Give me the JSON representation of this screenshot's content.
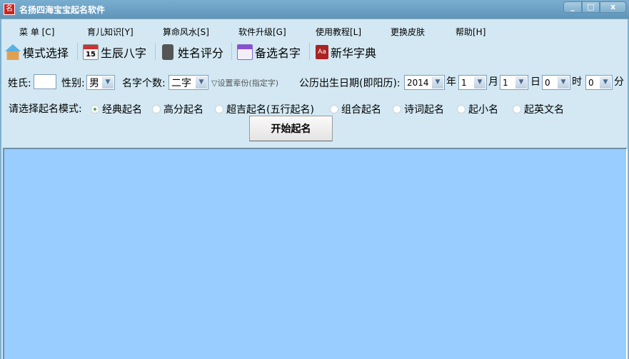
{
  "window": {
    "title": "名扬四海宝宝起名软件",
    "icon_text": "名"
  },
  "menu": [
    "菜  单 [C]",
    "育儿知识[Y]",
    "算命风水[S]",
    "软件升级[G]",
    "使用教程[L]",
    "更换皮肤",
    "帮助[H]"
  ],
  "toolbar": [
    "模式选择",
    "生辰八字",
    "姓名评分",
    "备选名字",
    "新华字典"
  ],
  "toolbar_icon_text": {
    "calendar": "15",
    "dict": "Aa"
  },
  "form": {
    "surname_label": "姓氏:",
    "surname_value": "",
    "gender_label": "性别:",
    "gender_value": "男",
    "count_label": "名字个数:",
    "count_value": "二字",
    "generation_link": "▽设置辈份(指定字)",
    "birth_label": "公历出生日期(即阳历):",
    "year": "2014",
    "year_unit": "年",
    "month": "1",
    "month_unit": "月",
    "day": "1",
    "day_unit": "日",
    "hour": "0",
    "hour_unit": "时",
    "minute": "0",
    "minute_unit": "分",
    "mode_label": "请选择起名模式:",
    "modes": [
      "经典起名",
      "高分起名",
      "超吉起名(五行起名)",
      "组合起名",
      "诗词起名",
      "起小名",
      "起英文名"
    ],
    "selected_mode": "经典起名",
    "start_button": "开始起名"
  }
}
